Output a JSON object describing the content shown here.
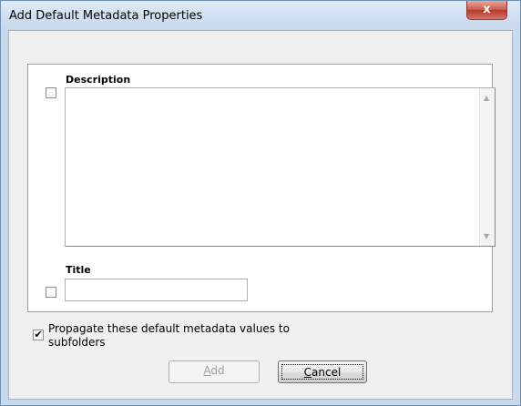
{
  "window": {
    "title": "Add Default Metadata Properties",
    "close_glyph": "x"
  },
  "fields": {
    "description": {
      "label": "Description",
      "checked": false,
      "value": ""
    },
    "title": {
      "label": "Title",
      "checked": false,
      "value": ""
    }
  },
  "propagate": {
    "checked": true,
    "label_line1": "Propagate these default metadata values to",
    "label_line2": "subfolders"
  },
  "buttons": {
    "add": {
      "label_prefix": "",
      "label_mnemonic": "A",
      "label_rest": "dd",
      "enabled": false
    },
    "cancel": {
      "label_prefix": "",
      "label_mnemonic": "C",
      "label_rest": "ancel",
      "enabled": true
    }
  },
  "icons": {
    "scroll_up": "▲",
    "scroll_down": "▼",
    "check": "✔"
  }
}
